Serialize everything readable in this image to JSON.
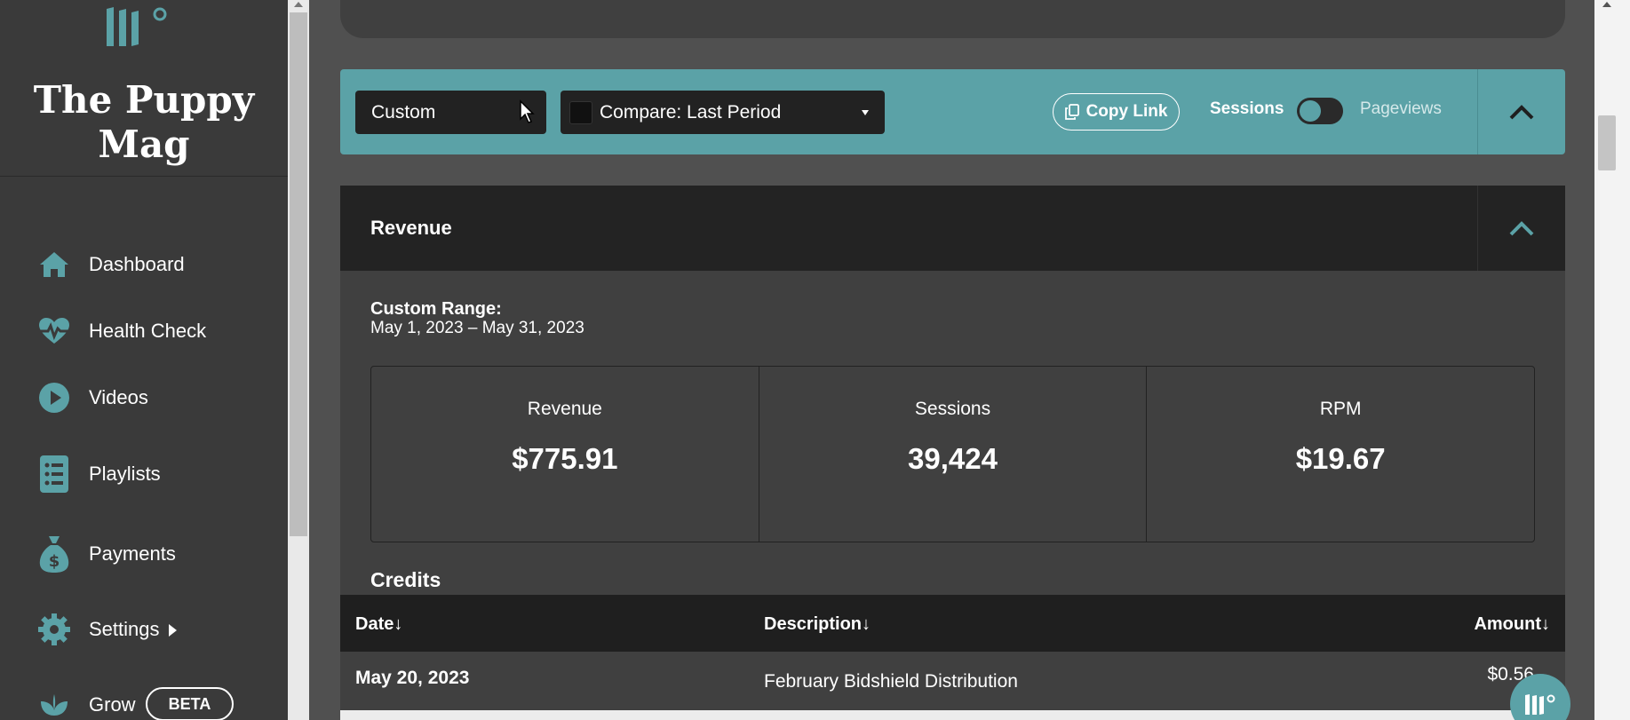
{
  "brand": {
    "name": "The Puppy Mag"
  },
  "sidebar": {
    "items": [
      {
        "label": "Dashboard",
        "icon": "home-icon"
      },
      {
        "label": "Health Check",
        "icon": "heartbeat-icon"
      },
      {
        "label": "Videos",
        "icon": "play-circle-icon"
      },
      {
        "label": "Playlists",
        "icon": "list-icon"
      },
      {
        "label": "Payments",
        "icon": "money-bag-icon"
      },
      {
        "label": "Settings",
        "icon": "gear-icon"
      },
      {
        "label": "Grow",
        "icon": "leaf-icon",
        "badge": "BETA"
      }
    ]
  },
  "filter_bar": {
    "range": "Custom",
    "compare": "Compare: Last Period",
    "copy_link": "Copy Link",
    "toggle_left": "Sessions",
    "toggle_right": "Pageviews"
  },
  "revenue": {
    "title": "Revenue",
    "range_heading": "Custom Range:",
    "range_dates": "May 1, 2023 – May 31, 2023",
    "stats": [
      {
        "label": "Revenue",
        "value": "$775.91"
      },
      {
        "label": "Sessions",
        "value": "39,424"
      },
      {
        "label": "RPM",
        "value": "$19.67"
      }
    ],
    "credits_heading": "Credits"
  },
  "credits_table": {
    "columns": [
      "Date↓",
      "Description↓",
      "Amount↓"
    ],
    "rows": [
      {
        "date": "May 20, 2023",
        "description": "February Bidshield Distribution",
        "amount": "$0.56"
      }
    ]
  },
  "colors": {
    "accent": "#5ba2a7",
    "sidebar": "#3a3a3a",
    "panel": "#404040",
    "header_dark": "#232323"
  }
}
